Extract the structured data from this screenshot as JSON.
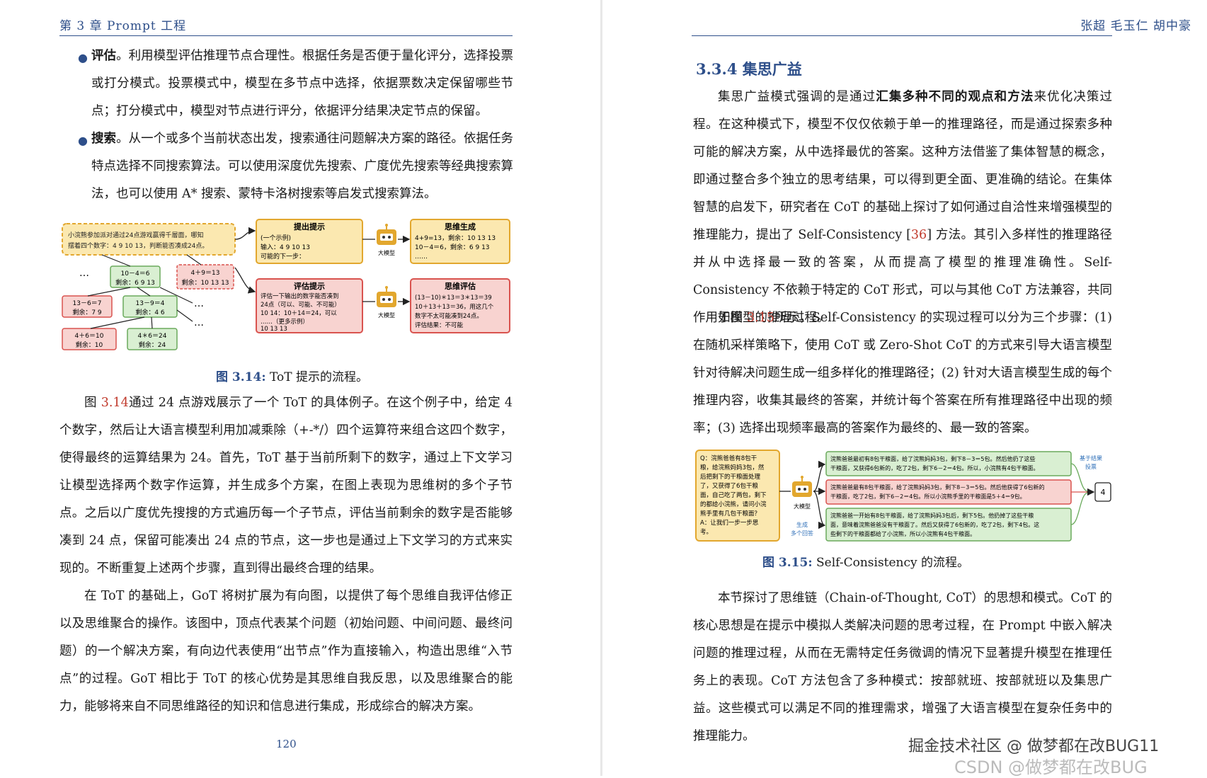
{
  "left": {
    "running_head": "第 3 章 Prompt 工程",
    "bullets": [
      {
        "term": "评估",
        "text": "。利用模型评估推理节点合理性。根据任务是否便于量化评分，选择投票或打分模式。投票模式中，模型在多节点中选择，依据票数决定保留哪些节点；打分模式中，模型对节点进行评分，依据评分结果决定节点的保留。"
      },
      {
        "term": "搜索",
        "text": "。从一个或多个当前状态出发，搜索通往问题解决方案的路径。依据任务特点选择不同搜索算法。可以使用深度优先搜索、广度优先搜索等经典搜索算法，也可以使用 A* 搜索、蒙特卡洛树搜索等启发式搜索算法。"
      }
    ],
    "fig314": {
      "question": "小浣熊参加派对通过24点游戏赢得千層面，哪知摆着四个数字：4 9 10 13，判断能否凑成24点。",
      "prompt_title": "提出提示",
      "prompt_lines": [
        "(一个示例)",
        "输入：4 9 10 13",
        "可能的下一步："
      ],
      "llm_label": "大模型",
      "thought_gen_title": "思维生成",
      "thought_gen_lines": [
        "4+9=13，剩余：10 13 13",
        "10－4＝6，剩余：6 9 13",
        "……"
      ],
      "eval_title": "评估提示",
      "eval_lines": [
        "评估一下输出的数字能否凑到",
        "24点（可以、可能、不可能）",
        "10 14：10＋14＝24，可以",
        "……（更多示例）",
        "10 13 13"
      ],
      "thought_eval_title": "思维评估",
      "thought_eval_lines": [
        "(13－10)＊13＝3＊13＝39",
        "10＋13＋13＝36，用这几个",
        "数字不太可能凑到24点。",
        "评估结果：不可能"
      ],
      "nodes": {
        "n1": [
          "10－4＝6",
          "剩余：6 9 13"
        ],
        "n2": [
          "4＋9＝13",
          "剩余：10 13 13"
        ],
        "n3": [
          "13－6＝7",
          "剩余：7 9"
        ],
        "n4": [
          "13－9＝4",
          "剩余：4 6"
        ],
        "n5": [
          "4＋6＝10",
          "剩余：10"
        ],
        "n6": [
          "4＊6＝24",
          "剩余：24"
        ]
      },
      "ellipsis": "…",
      "caption_label": "图 3.14:",
      "caption_text": " ToT 提示的流程。"
    },
    "para1_pre": "图 ",
    "para1_ref": "3.14",
    "para1_post": "通过 24 点游戏展示了一个 ToT 的具体例子。在这个例子中，给定 4 个数字，然后让大语言模型利用加减乘除（+-*/）四个运算符来组合这四个数字，使得最终的运算结果为 24。首先，ToT 基于当前所剩下的数字，通过上下文学习让模型选择两个数字作运算，并生成多个方案，在图上表现为思维树的多个子节点。之后以广度优先搜搜的方式遍历每一个子节点，评估当前剩余的数字是否能够凑到 24 点，保留可能凑出 24 点的节点，这一步也是通过上下文学习的方式来实现的。不断重复上述两个步骤，直到得出最终合理的结果。",
    "para2": "在 ToT 的基础上，GoT 将树扩展为有向图，以提供了每个思维自我评估修正以及思维聚合的操作。该图中，顶点代表某个问题（初始问题、中间问题、最终问题）的一个解决方案，有向边代表使用“出节点”作为直接输入，构造出思维“入节点”的过程。GoT 相比于 ToT 的核心优势是其思维自我反思，以及思维聚合的能力，能够将来自不同思维路径的知识和信息进行集成，形成综合的解决方案。",
    "page_number": "120"
  },
  "right": {
    "running_head": "张超 毛玉仁 胡中豪",
    "section_title": "3.3.4  集思广益",
    "p1_a": "集思广益模式强调的是通过",
    "p1_bold": "汇集多种不同的观点和方法",
    "p1_b": "来优化决策过程。在这种模式下，模型不仅仅依赖于单一的推理路径，而是通过探索多种可能的解决方案，从中选择最优的答案。这种方法借鉴了集体智慧的概念，即通过整合多个独立的思考结果，可以得到更全面、更准确的结论。在集体智慧的启发下，研究者在 CoT 的基础上探讨了如何通过自洽性来增强模型的推理能力，提出了 Self-Consistency [",
    "p1_ref": "36",
    "p1_c": "] 方法。其引入多样性的推理路径并从中选择最一致的答案，从而提高了模型的推理准确性。Self-Consistency 不依赖于特定的 CoT 形式，可以与其他 CoT 方法兼容，共同作用于模型的推理过程。",
    "p2_a": "如图 ",
    "p2_ref": "3.15",
    "p2_b": "所示，Self-Consistency 的实现过程可以分为三个步骤：(1) 在随机采样策略下，使用 CoT 或 Zero-Shot CoT 的方式来引导大语言模型针对待解决问题生成一组多样化的推理路径；(2) 针对大语言模型生成的每个推理内容，收集其最终的答案，并统计每个答案在所有推理路径中出现的频率；(3) 选择出现频率最高的答案作为最终的、最一致的答案。",
    "fig315": {
      "question_lines": [
        "Q：浣熊爸爸有8包干",
        "粮，给浣熊妈妈3包，然",
        "后把剩下的干粮面处理",
        "了，又获得了6包干粮",
        "面，自己吃了两包，剩下",
        "的都给小浣熊，请问小浣",
        "熊手里有几包干粮面？",
        "A：让我们一步一步思",
        "考。"
      ],
      "llm_label": "大模型",
      "gen_label_1": "生成",
      "gen_label_2": "多个回答",
      "path1": [
        "浣熊爸爸最初有8包干粮面，给了浣熊妈妈3包，剩下8－3＝5包。然后他扔了这些",
        "干粮面，又获得6包新的，吃了2包，剩下6－2＝4包。所以，小浣熊有4包干粮面。"
      ],
      "path2": [
        "浣熊爸爸最有8包干粮面，给了浣熊妈妈3包，剩下8－3＝5包。然后他获得了6包新的",
        "干粮面，吃了2包，剩下6－2＝4包。所以小浣熊手里的干粮面是5＋4＝9包。"
      ],
      "path3": [
        "浣熊爸爸一开始有8包干粮面，给了浣熊妈妈3包后，剩下5包。他扔掉了这些干粮",
        "面，意味着浣熊爸爸没有干粮面了。然后又获得了6包新的，吃了2包，剩下4包。这",
        "些剩下的干粮面都给了小浣熊，所以小浣熊有4包干粮面。"
      ],
      "vote_label_1": "基于结果",
      "vote_label_2": "投票",
      "answer": "4",
      "caption_label": "图 3.15:",
      "caption_text": " Self-Consistency 的流程。"
    },
    "p3": "本节探讨了思维链（Chain-of-Thought, CoT）的思想和模式。CoT 的核心思想是在提示中模拟人类解决问题的思考过程，在 Prompt 中嵌入解决问题的推理过程，从而在无需特定任务微调的情况下显著提升模型在推理任务上的表现。CoT 方法包含了多种模式：按部就班、按部就班以及集思广益。这些模式可以满足不同的推理需求，增强了大语言模型在复杂任务中的推理能力。",
    "watermark_1": "掘金技术社区 @ 做梦都在改BUG11",
    "watermark_2": "CSDN @做梦都在改BUG"
  },
  "colors": {
    "heading_blue": "#2e4f8a",
    "ref_red": "#c0392b",
    "yellow_box": "#fbe8b0",
    "yellow_border": "#e2a72e",
    "red_box": "#f8d3d0",
    "red_border": "#d9534f",
    "green_box": "#d9efd2",
    "green_border": "#6aaa5c",
    "robot": "#e2a72e"
  }
}
